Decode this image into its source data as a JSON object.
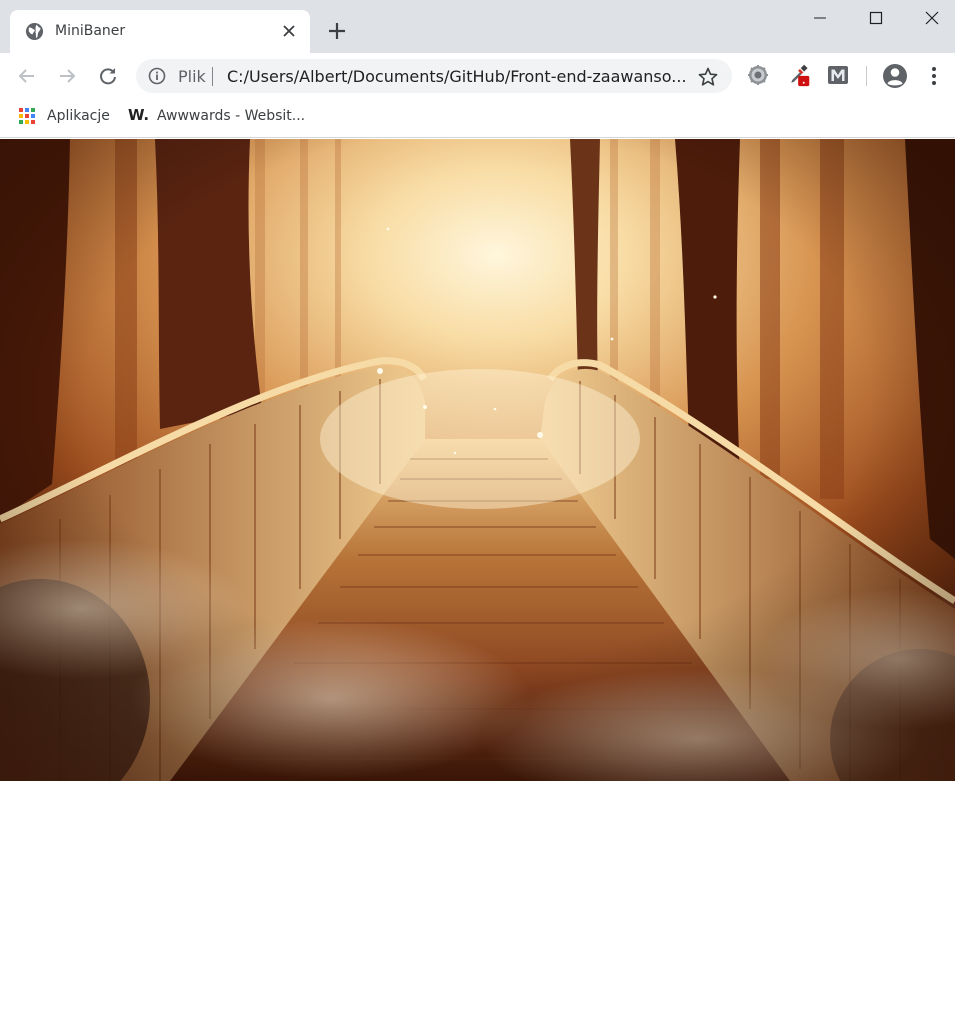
{
  "tab": {
    "title": "MiniBaner",
    "favicon": "globe-icon",
    "close_icon": "close-icon",
    "new_tab_icon": "plus-icon"
  },
  "window_controls": [
    "minimize-icon",
    "maximize-icon",
    "close-icon"
  ],
  "toolbar": {
    "back_icon": "arrow-back-icon",
    "forward_icon": "arrow-forward-icon",
    "reload_icon": "reload-icon",
    "site_info_icon": "info-icon",
    "scheme_label": "Plik",
    "url": "C:/Users/Albert/Documents/GitHub/Front-end-zaawanso...",
    "bookmark_icon": "star-icon",
    "extensions": [
      "gear-extension-icon",
      "eyedropper-extension-icon",
      "m-extension-icon"
    ],
    "profile_icon": "account-circle-icon",
    "menu_icon": "kebab-menu-icon"
  },
  "bookmarks": [
    {
      "label": "Aplikacje",
      "icon": "apps-grid-icon"
    },
    {
      "label": "Awwwards - Websit...",
      "icon_text": "W."
    }
  ],
  "page": {
    "banner_image": "misty autumn forest with wooden bridge",
    "colors": {
      "mist": "#f8e3b5",
      "wood": "#a4622b",
      "dark": "#3b1707"
    }
  }
}
